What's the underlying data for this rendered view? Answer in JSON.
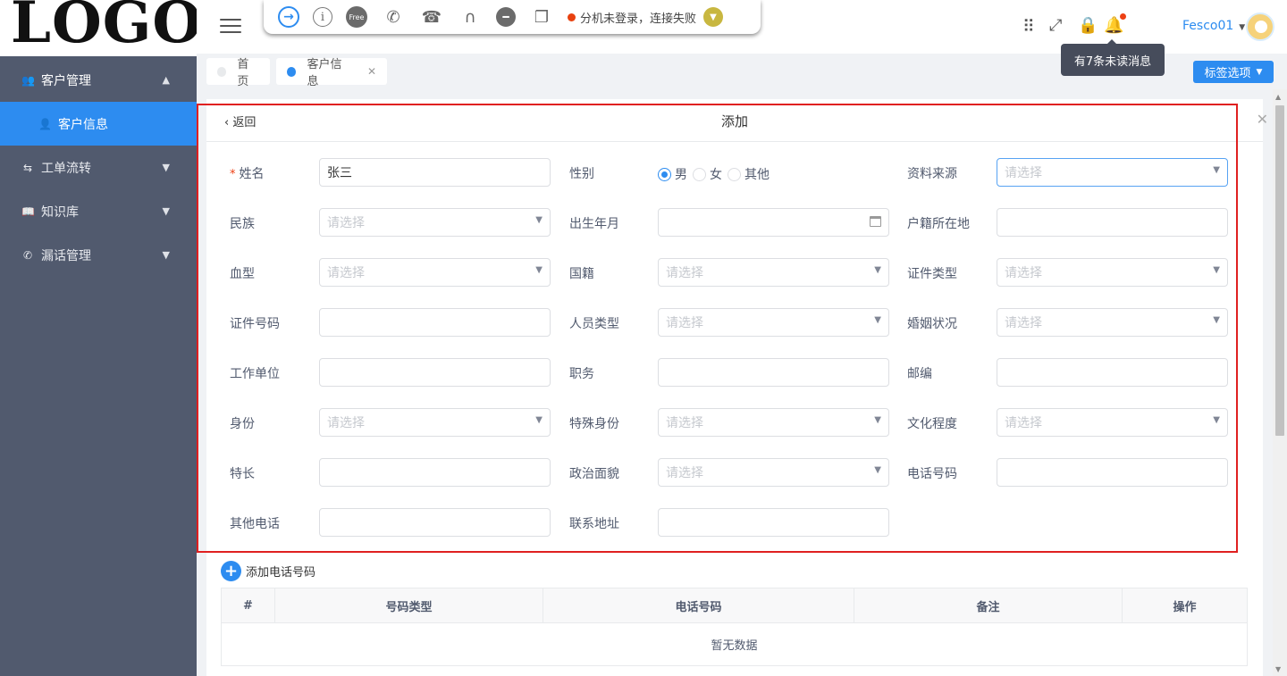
{
  "logo": "LOGO",
  "sidebar": {
    "items": [
      {
        "label": "客户管理",
        "icon": "group-icon",
        "chevron": "⌃"
      },
      {
        "label": "客户信息",
        "icon": "user-add-icon",
        "chevron": ""
      },
      {
        "label": "工单流转",
        "icon": "flow-icon",
        "chevron": "⌄"
      },
      {
        "label": "知识库",
        "icon": "book-icon",
        "chevron": "⌄"
      },
      {
        "label": "漏话管理",
        "icon": "phone-icon",
        "chevron": "⌄"
      }
    ]
  },
  "phonebar": {
    "free_label": "Free",
    "status": "分机未登录，连接失败"
  },
  "header": {
    "tooltip": "有7条未读消息",
    "user": "Fesco01"
  },
  "tabs": [
    {
      "label": "首页"
    },
    {
      "label": "客户信息"
    }
  ],
  "tag_options": "标签选项",
  "form": {
    "back": "返回",
    "title": "添加",
    "placeholder": "请选择",
    "fields": [
      {
        "label": "姓名",
        "value": "张三",
        "required": true,
        "type": "text"
      },
      {
        "label": "性别",
        "type": "radio",
        "options": [
          "男",
          "女",
          "其他"
        ],
        "selected": "男"
      },
      {
        "label": "资料来源",
        "type": "select",
        "value": ""
      },
      {
        "label": "民族",
        "type": "select",
        "value": ""
      },
      {
        "label": "出生年月",
        "type": "date",
        "value": ""
      },
      {
        "label": "户籍所在地",
        "type": "text",
        "value": ""
      },
      {
        "label": "血型",
        "type": "select",
        "value": ""
      },
      {
        "label": "国籍",
        "type": "select",
        "value": ""
      },
      {
        "label": "证件类型",
        "type": "select",
        "value": ""
      },
      {
        "label": "证件号码",
        "type": "text",
        "value": ""
      },
      {
        "label": "人员类型",
        "type": "select",
        "value": ""
      },
      {
        "label": "婚姻状况",
        "type": "select",
        "value": ""
      },
      {
        "label": "工作单位",
        "type": "text",
        "value": ""
      },
      {
        "label": "职务",
        "type": "text",
        "value": ""
      },
      {
        "label": "邮编",
        "type": "text",
        "value": ""
      },
      {
        "label": "身份",
        "type": "select",
        "value": ""
      },
      {
        "label": "特殊身份",
        "type": "select",
        "value": ""
      },
      {
        "label": "文化程度",
        "type": "select",
        "value": ""
      },
      {
        "label": "特长",
        "type": "text",
        "value": ""
      },
      {
        "label": "政治面貌",
        "type": "select",
        "value": ""
      },
      {
        "label": "电话号码",
        "type": "text",
        "value": ""
      },
      {
        "label": "其他电话",
        "type": "text",
        "value": ""
      },
      {
        "label": "联系地址",
        "type": "text",
        "value": ""
      }
    ]
  },
  "phone_table": {
    "add_label": "添加电话号码",
    "columns": [
      "#",
      "号码类型",
      "电话号码",
      "备注",
      "操作"
    ],
    "empty": "暂无数据"
  }
}
